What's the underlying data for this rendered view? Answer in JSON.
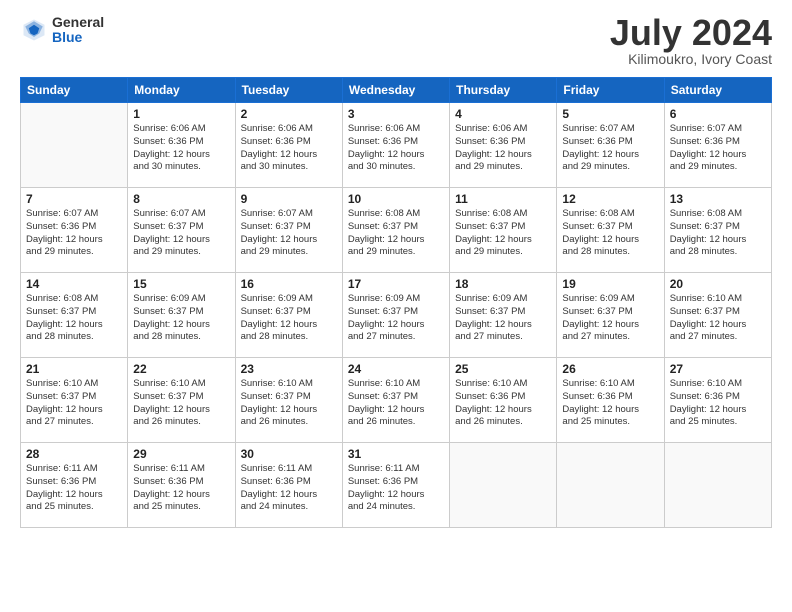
{
  "logo": {
    "general": "General",
    "blue": "Blue"
  },
  "title": "July 2024",
  "subtitle": "Kilimoukro, Ivory Coast",
  "calendar": {
    "headers": [
      "Sunday",
      "Monday",
      "Tuesday",
      "Wednesday",
      "Thursday",
      "Friday",
      "Saturday"
    ],
    "weeks": [
      [
        {
          "day": "",
          "info": ""
        },
        {
          "day": "1",
          "info": "Sunrise: 6:06 AM\nSunset: 6:36 PM\nDaylight: 12 hours\nand 30 minutes."
        },
        {
          "day": "2",
          "info": "Sunrise: 6:06 AM\nSunset: 6:36 PM\nDaylight: 12 hours\nand 30 minutes."
        },
        {
          "day": "3",
          "info": "Sunrise: 6:06 AM\nSunset: 6:36 PM\nDaylight: 12 hours\nand 30 minutes."
        },
        {
          "day": "4",
          "info": "Sunrise: 6:06 AM\nSunset: 6:36 PM\nDaylight: 12 hours\nand 29 minutes."
        },
        {
          "day": "5",
          "info": "Sunrise: 6:07 AM\nSunset: 6:36 PM\nDaylight: 12 hours\nand 29 minutes."
        },
        {
          "day": "6",
          "info": "Sunrise: 6:07 AM\nSunset: 6:36 PM\nDaylight: 12 hours\nand 29 minutes."
        }
      ],
      [
        {
          "day": "7",
          "info": "Sunrise: 6:07 AM\nSunset: 6:36 PM\nDaylight: 12 hours\nand 29 minutes."
        },
        {
          "day": "8",
          "info": "Sunrise: 6:07 AM\nSunset: 6:37 PM\nDaylight: 12 hours\nand 29 minutes."
        },
        {
          "day": "9",
          "info": "Sunrise: 6:07 AM\nSunset: 6:37 PM\nDaylight: 12 hours\nand 29 minutes."
        },
        {
          "day": "10",
          "info": "Sunrise: 6:08 AM\nSunset: 6:37 PM\nDaylight: 12 hours\nand 29 minutes."
        },
        {
          "day": "11",
          "info": "Sunrise: 6:08 AM\nSunset: 6:37 PM\nDaylight: 12 hours\nand 29 minutes."
        },
        {
          "day": "12",
          "info": "Sunrise: 6:08 AM\nSunset: 6:37 PM\nDaylight: 12 hours\nand 28 minutes."
        },
        {
          "day": "13",
          "info": "Sunrise: 6:08 AM\nSunset: 6:37 PM\nDaylight: 12 hours\nand 28 minutes."
        }
      ],
      [
        {
          "day": "14",
          "info": "Sunrise: 6:08 AM\nSunset: 6:37 PM\nDaylight: 12 hours\nand 28 minutes."
        },
        {
          "day": "15",
          "info": "Sunrise: 6:09 AM\nSunset: 6:37 PM\nDaylight: 12 hours\nand 28 minutes."
        },
        {
          "day": "16",
          "info": "Sunrise: 6:09 AM\nSunset: 6:37 PM\nDaylight: 12 hours\nand 28 minutes."
        },
        {
          "day": "17",
          "info": "Sunrise: 6:09 AM\nSunset: 6:37 PM\nDaylight: 12 hours\nand 27 minutes."
        },
        {
          "day": "18",
          "info": "Sunrise: 6:09 AM\nSunset: 6:37 PM\nDaylight: 12 hours\nand 27 minutes."
        },
        {
          "day": "19",
          "info": "Sunrise: 6:09 AM\nSunset: 6:37 PM\nDaylight: 12 hours\nand 27 minutes."
        },
        {
          "day": "20",
          "info": "Sunrise: 6:10 AM\nSunset: 6:37 PM\nDaylight: 12 hours\nand 27 minutes."
        }
      ],
      [
        {
          "day": "21",
          "info": "Sunrise: 6:10 AM\nSunset: 6:37 PM\nDaylight: 12 hours\nand 27 minutes."
        },
        {
          "day": "22",
          "info": "Sunrise: 6:10 AM\nSunset: 6:37 PM\nDaylight: 12 hours\nand 26 minutes."
        },
        {
          "day": "23",
          "info": "Sunrise: 6:10 AM\nSunset: 6:37 PM\nDaylight: 12 hours\nand 26 minutes."
        },
        {
          "day": "24",
          "info": "Sunrise: 6:10 AM\nSunset: 6:37 PM\nDaylight: 12 hours\nand 26 minutes."
        },
        {
          "day": "25",
          "info": "Sunrise: 6:10 AM\nSunset: 6:36 PM\nDaylight: 12 hours\nand 26 minutes."
        },
        {
          "day": "26",
          "info": "Sunrise: 6:10 AM\nSunset: 6:36 PM\nDaylight: 12 hours\nand 25 minutes."
        },
        {
          "day": "27",
          "info": "Sunrise: 6:10 AM\nSunset: 6:36 PM\nDaylight: 12 hours\nand 25 minutes."
        }
      ],
      [
        {
          "day": "28",
          "info": "Sunrise: 6:11 AM\nSunset: 6:36 PM\nDaylight: 12 hours\nand 25 minutes."
        },
        {
          "day": "29",
          "info": "Sunrise: 6:11 AM\nSunset: 6:36 PM\nDaylight: 12 hours\nand 25 minutes."
        },
        {
          "day": "30",
          "info": "Sunrise: 6:11 AM\nSunset: 6:36 PM\nDaylight: 12 hours\nand 24 minutes."
        },
        {
          "day": "31",
          "info": "Sunrise: 6:11 AM\nSunset: 6:36 PM\nDaylight: 12 hours\nand 24 minutes."
        },
        {
          "day": "",
          "info": ""
        },
        {
          "day": "",
          "info": ""
        },
        {
          "day": "",
          "info": ""
        }
      ]
    ]
  }
}
